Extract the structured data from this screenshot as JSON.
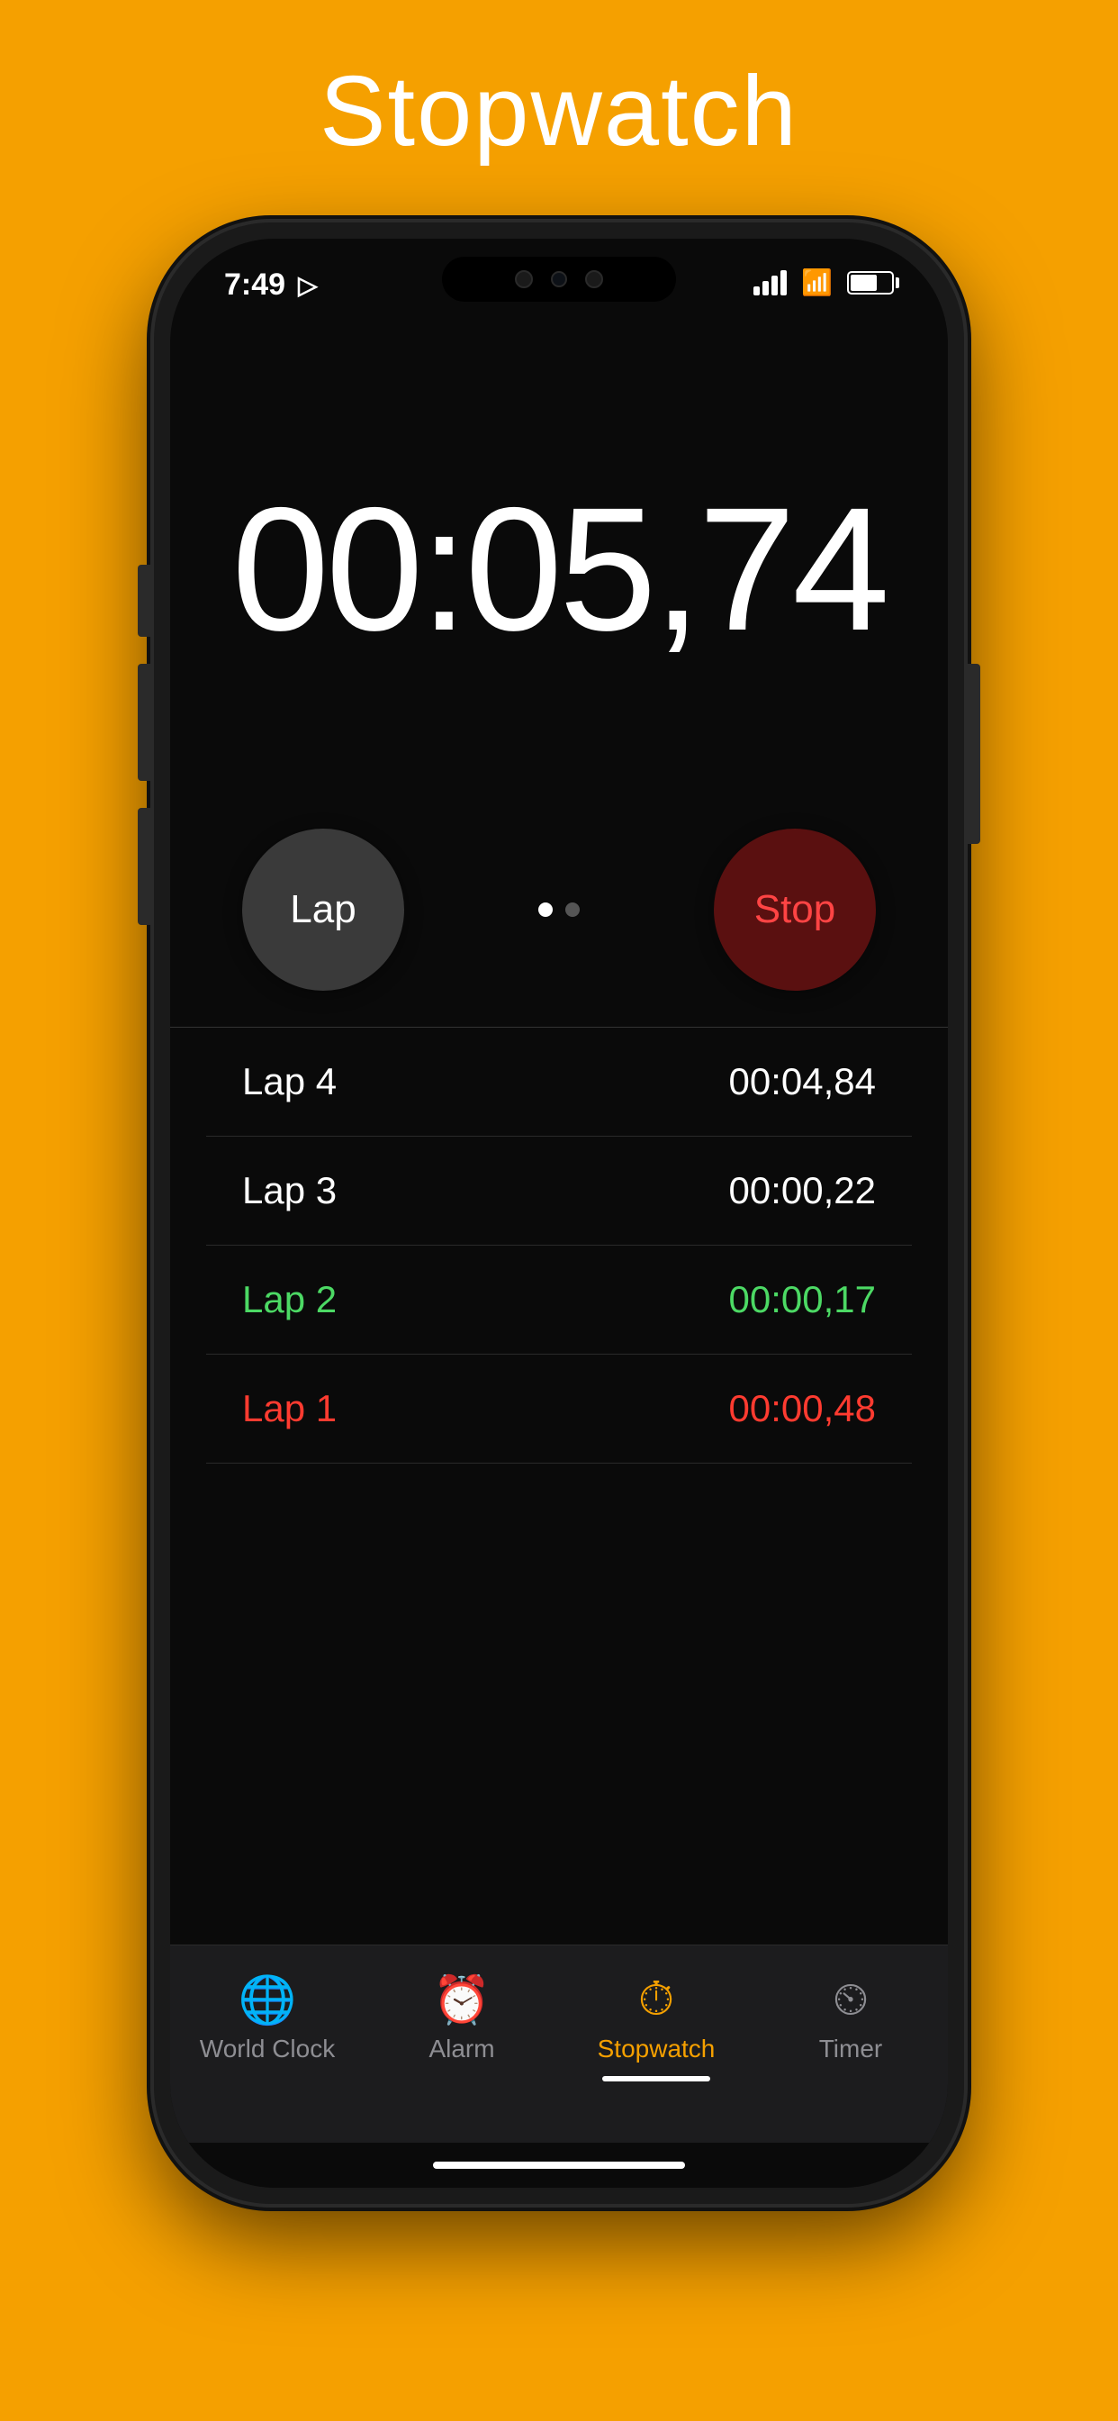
{
  "page": {
    "title": "Stopwatch",
    "background_color": "#F5A000"
  },
  "status_bar": {
    "time": "7:49",
    "location_icon": "▷"
  },
  "timer": {
    "display": "00:05,74"
  },
  "controls": {
    "lap_label": "Lap",
    "stop_label": "Stop"
  },
  "dots": [
    {
      "active": true
    },
    {
      "active": false
    }
  ],
  "laps": [
    {
      "id": "lap4",
      "name": "Lap 4",
      "time": "00:04,84",
      "style": "normal"
    },
    {
      "id": "lap3",
      "name": "Lap 3",
      "time": "00:00,22",
      "style": "normal"
    },
    {
      "id": "lap2",
      "name": "Lap 2",
      "time": "00:00,17",
      "style": "best"
    },
    {
      "id": "lap1",
      "name": "Lap 1",
      "time": "00:00,48",
      "style": "worst"
    }
  ],
  "tabs": [
    {
      "id": "world-clock",
      "label": "World Clock",
      "icon": "🌐",
      "active": false
    },
    {
      "id": "alarm",
      "label": "Alarm",
      "icon": "⏰",
      "active": false
    },
    {
      "id": "stopwatch",
      "label": "Stopwatch",
      "icon": "⏱",
      "active": true
    },
    {
      "id": "timer",
      "label": "Timer",
      "icon": "⏲",
      "active": false
    }
  ]
}
